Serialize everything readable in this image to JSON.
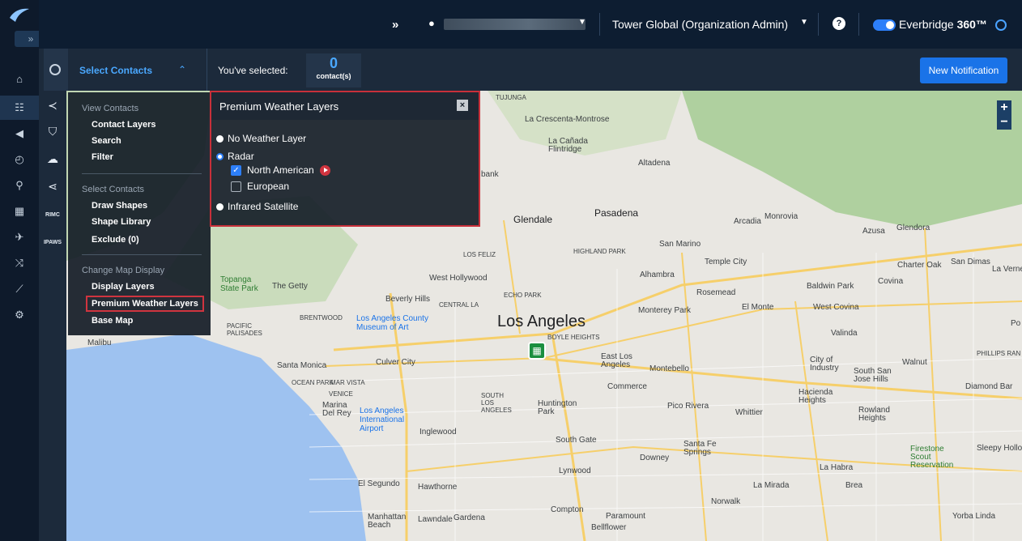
{
  "topbar": {
    "org_label": "Tower Global (Organization Admin)",
    "brand_label": "Everbridge",
    "brand_suffix": "360™",
    "help_label": "?"
  },
  "subbar": {
    "select_contacts_label": "Select Contacts",
    "selected_label": "You've selected:",
    "selected_count": "0",
    "selected_unit": "contact(s)",
    "new_notification_label": "New Notification"
  },
  "icon_column": {
    "rimc_label": "RIMC",
    "ipaws_label": "IPAWS"
  },
  "menu": {
    "view_contacts_heading": "View Contacts",
    "contact_layers": "Contact Layers",
    "search": "Search",
    "filter": "Filter",
    "select_contacts_heading": "Select Contacts",
    "draw_shapes": "Draw Shapes",
    "shape_library": "Shape Library",
    "exclude": "Exclude (0)",
    "change_map_heading": "Change Map Display",
    "display_layers": "Display Layers",
    "premium_weather_layers": "Premium Weather Layers",
    "base_map": "Base Map"
  },
  "weather_panel": {
    "title": "Premium Weather Layers",
    "close_label": "×",
    "no_weather": "No Weather Layer",
    "radar": "Radar",
    "north_american": "North American",
    "european": "European",
    "infrared": "Infrared Satellite",
    "selected_option": "Radar",
    "north_american_checked": true,
    "european_checked": false
  },
  "map": {
    "labels": {
      "la": "Los Angeles",
      "glendale": "Glendale",
      "pasadena": "Pasadena",
      "monrovia": "Monrovia",
      "azusa": "Azusa",
      "glendora": "Glendora",
      "lacrescenta": "La Crescenta-Montrose",
      "lacanada": "La Cañada Flintridge",
      "altadena": "Altadena",
      "sanmarino": "San Marino",
      "templecity": "Temple City",
      "arcadia": "Arcadia",
      "alhambra": "Alhambra",
      "rosemead": "Rosemead",
      "baldwinpark": "Baldwin Park",
      "covina": "Covina",
      "charteroak": "Charter Oak",
      "sandimas": "San Dimas",
      "laverne": "La Verne",
      "elmonte": "El Monte",
      "westcovina": "West Covina",
      "monterey": "Monterey Park",
      "valinda": "Valinda",
      "hollywood": "West Hollywood",
      "beverlyhills": "Beverly Hills",
      "getty": "The Getty",
      "topanga": "Topanga State Park",
      "lacma": "Los Angeles County Museum of Art",
      "santamonica": "Santa Monica",
      "culvercity": "Culver City",
      "malibu": "Malibu",
      "marina": "Marina Del Rey",
      "lax": "Los Angeles International Airport",
      "inglewood": "Inglewood",
      "eastla": "East Los Angeles",
      "montebello": "Montebello",
      "commerce": "Commerce",
      "picorivera": "Pico Rivera",
      "whittier": "Whittier",
      "cityindustry": "City of Industry",
      "sanjose": "South San Jose Hills",
      "walnut": "Walnut",
      "diamondbar": "Diamond Bar",
      "hacienda": "Hacienda Heights",
      "rowland": "Rowland Heights",
      "huntington": "Huntington Park",
      "southgate": "South Gate",
      "santafe": "Santa Fe Springs",
      "downey": "Downey",
      "lahabra": "La Habra",
      "lynwood": "Lynwood",
      "elsegundo": "El Segundo",
      "hawthorne": "Hawthorne",
      "compton": "Compton",
      "paramount": "Paramount",
      "norwalk": "Norwalk",
      "lamirada": "La Mirada",
      "brea": "Brea",
      "manhattan": "Manhattan Beach",
      "lawndale": "Lawndale",
      "gardena": "Gardena",
      "bellflower": "Bellflower",
      "yorbalinda": "Yorba Linda",
      "stonescout": "Firestone Scout Reservation",
      "sleepy": "Sleepy Hollow",
      "phillips": "PHILLIPS RAN",
      "burbank": "bank",
      "tujunga": "TUJUNGA",
      "losfeliz": "LOS FELIZ",
      "highland": "HIGHLAND PARK",
      "echopark": "ECHO PARK",
      "central": "CENTRAL LA",
      "boyle": "BOYLE HEIGHTS",
      "brentwood": "BRENTWOOD",
      "pacific": "PACIFIC PALISADES",
      "oceanpark": "OCEAN PARK",
      "marvista": "MAR VISTA",
      "venice": "VENICE",
      "southla": "SOUTH LOS ANGELES",
      "po": "Po"
    }
  }
}
